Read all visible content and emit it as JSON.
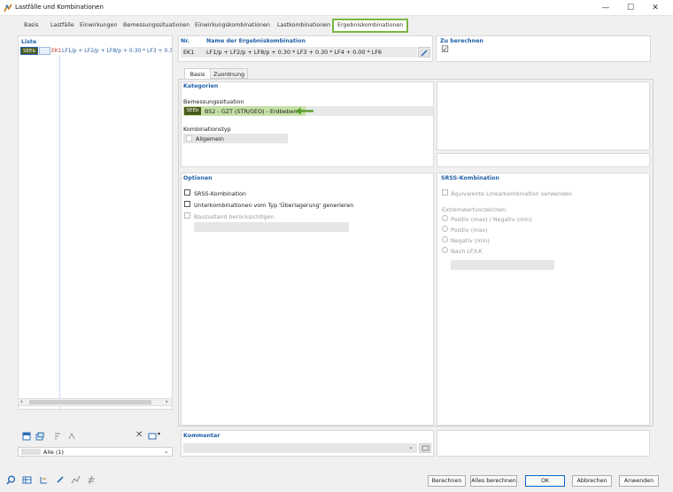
{
  "window": {
    "title": "Lastfälle und Kombinationen",
    "minimize": "—",
    "maximize": "☐",
    "close": "✕"
  },
  "tabs": [
    "Basis",
    "Lastfälle",
    "Einwirkungen",
    "Bemessungssituationen",
    "Einwirkungskombinationen",
    "Lastkombinationen",
    "Ergebniskombinationen"
  ],
  "list": {
    "header": "Liste",
    "item": {
      "badge": "SEEb",
      "code": "EK1",
      "text": "LF1/p + LF2/p + LF8/p + 0.30 * LF3 + 0.30 *"
    },
    "filter": "Alle (1)"
  },
  "header_fields": {
    "nr_label": "Nr.",
    "nr_value": "EK1",
    "name_label": "Name der Ergebniskombination",
    "name_value": "LF1/p + LF2/p + LF8/p + 0.30 * LF3 + 0.30 * LF4 + 0.00 * LF6",
    "calc_label": "Zu berechnen",
    "calc_checked": "☑"
  },
  "subtabs": [
    "Basis",
    "Zuordnung"
  ],
  "kategorien": {
    "header": "Kategorien",
    "design_label": "Bemessungssituation",
    "design_badge": "SEEb",
    "design_value": "BS2 - GZT (STR/GEO) - Erdbeben",
    "combo_label": "Kombinationstyp",
    "combo_value": "Allgemein"
  },
  "optionen": {
    "header": "Optionen",
    "srss": "SRSS-Kombination",
    "sub": "Unterkombinationen vom Typ 'Überlagerung' generieren",
    "bau": "Bauzustand berücksichtigen"
  },
  "srss": {
    "header": "SRSS-Kombination",
    "aequiv": "Äquivalente Linearkombination verwenden",
    "extrem": "Extremwertvorzeichen",
    "options": [
      "Positiv (max) / Negativ (min)",
      "Positiv (max)",
      "Negativ (min)",
      "Nach LF/LK"
    ]
  },
  "kommentar": {
    "header": "Kommentar"
  },
  "buttons": {
    "berechnen": "Berechnen",
    "alles": "Alles berechnen",
    "ok": "OK",
    "abbrechen": "Abbrechen",
    "anwenden": "Anwenden"
  },
  "colors": {
    "accent_green": "#7ab648",
    "badge_dark": "#4a5a1c",
    "highlight": "#c6e0a6",
    "blue_label": "#1f5fa8"
  }
}
